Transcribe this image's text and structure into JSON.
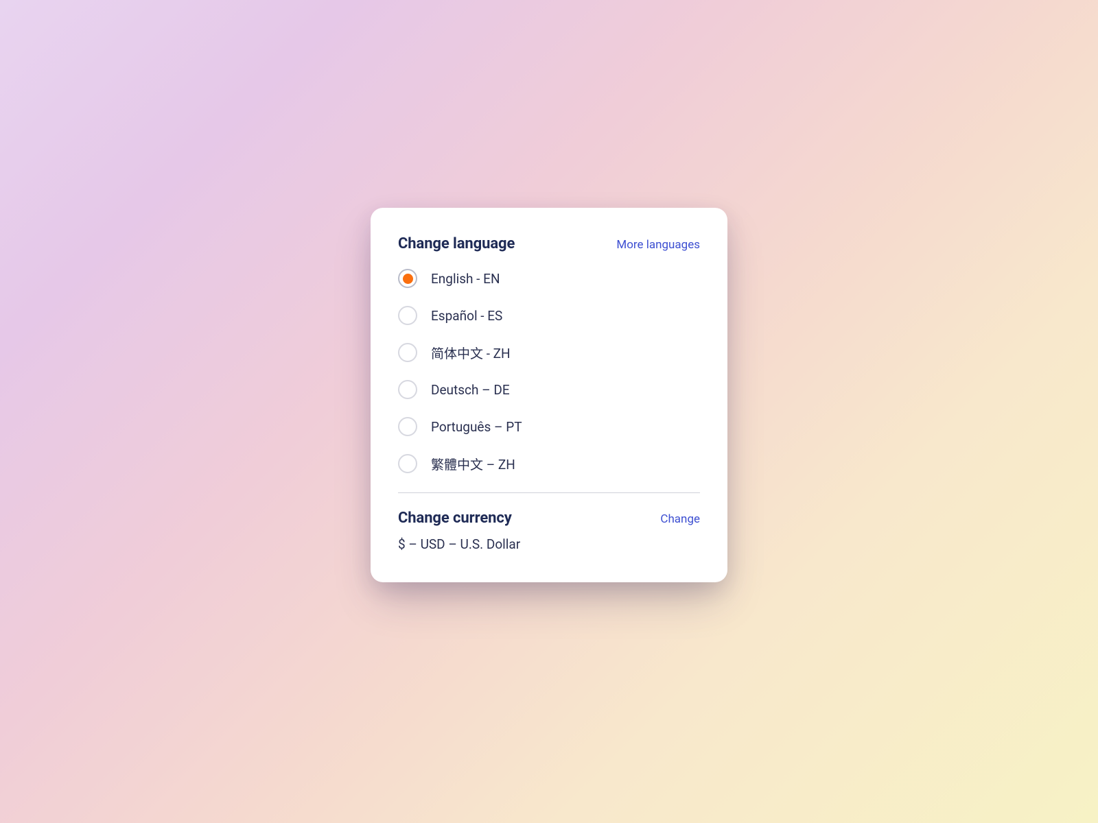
{
  "language": {
    "title": "Change language",
    "more_link": "More languages",
    "items": [
      {
        "label": "English - EN",
        "selected": true
      },
      {
        "label": "Español - ES",
        "selected": false
      },
      {
        "label": "简体中文 - ZH",
        "selected": false
      },
      {
        "label": "Deutsch – DE",
        "selected": false
      },
      {
        "label": "Português – PT",
        "selected": false
      },
      {
        "label": "繁體中文 – ZH",
        "selected": false
      }
    ]
  },
  "currency": {
    "title": "Change currency",
    "change_link": "Change",
    "value": "$ – USD – U.S. Dollar"
  },
  "colors": {
    "accent_orange": "#fa6f0f",
    "link_blue": "#3d4fd1",
    "title_navy": "#1e2a55",
    "text_navy": "#2a3050"
  }
}
